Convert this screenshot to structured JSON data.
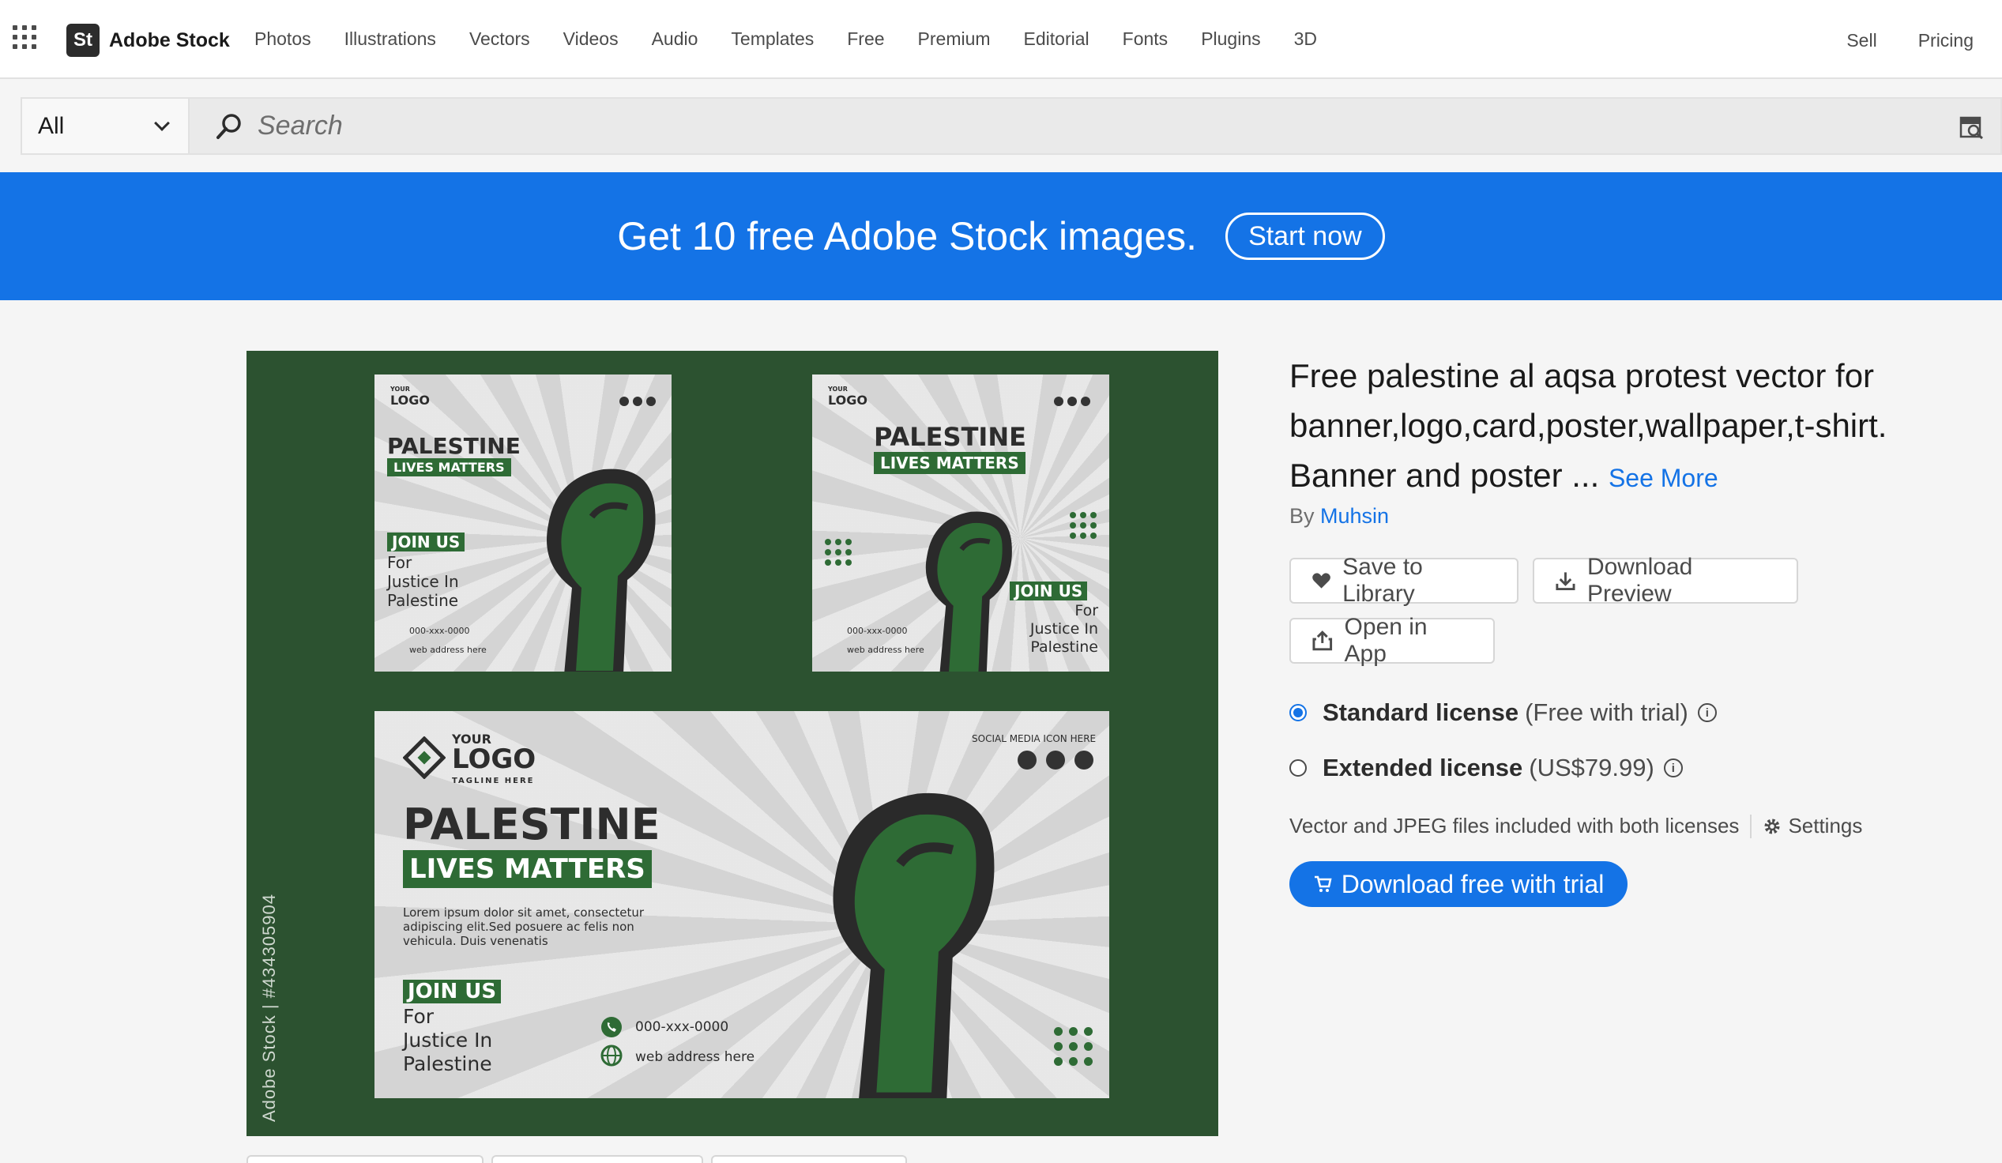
{
  "header": {
    "brand_mark": "St",
    "brand_name": "Adobe Stock",
    "nav": [
      "Photos",
      "Illustrations",
      "Vectors",
      "Videos",
      "Audio",
      "Templates",
      "Free",
      "Premium",
      "Editorial",
      "Fonts",
      "Plugins",
      "3D"
    ],
    "right": [
      "Sell",
      "Pricing"
    ]
  },
  "search": {
    "scope": "All",
    "placeholder": "Search"
  },
  "banner": {
    "text": "Get 10 free Adobe Stock images.",
    "button": "Start now",
    "color": "#1473e6"
  },
  "preview": {
    "watermark": "Adobe Stock | #434305904",
    "bg_color": "#2c5230",
    "accent_color": "#2e6b35",
    "card": {
      "logo_your": "YOUR",
      "logo": "LOGO",
      "tagline": "TAGLINE HERE",
      "social": "SOCIAL MEDIA ICON HERE",
      "headline": "PALESTINE",
      "subhead": "LIVES MATTERS",
      "lorem": "Lorem ipsum dolor sit amet, consectetur adipiscing elit.Sed posuere ac felis non vehicula. Duis venenatis",
      "join": "JOIN US",
      "for": "For",
      "justice": "Justice In",
      "place": "Palestine",
      "phone": "000-xxx-0000",
      "web": "web address here"
    }
  },
  "asset": {
    "title": "Free palestine al aqsa protest vector for banner,logo,card,poster,wallpaper,t-shirt. Banner and poster ...",
    "see_more": "See More",
    "by_label": "By",
    "author": "Muhsin",
    "actions": {
      "save": "Save to Library",
      "download_preview": "Download Preview",
      "open_app": "Open in App"
    },
    "licenses": [
      {
        "name": "Standard license",
        "price": "(Free with trial)",
        "selected": true
      },
      {
        "name": "Extended license",
        "price": "(US$79.99)",
        "selected": false
      }
    ],
    "file_info": "Vector and JPEG files included with both licenses",
    "settings": "Settings",
    "cta": "Download free with trial"
  }
}
